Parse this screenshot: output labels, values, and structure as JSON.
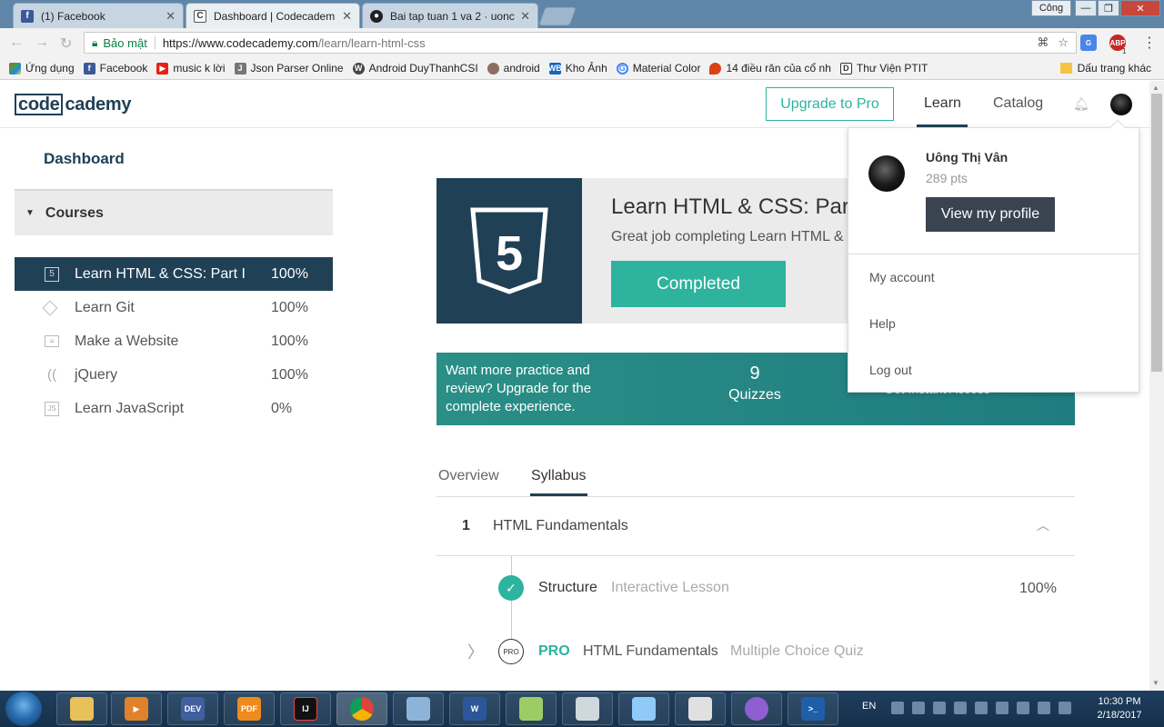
{
  "browser": {
    "tabs": [
      {
        "title": "(1) Facebook",
        "icon": "facebook-icon",
        "active": false
      },
      {
        "title": "Dashboard | Codecadem",
        "icon": "codecademy-icon",
        "active": true
      },
      {
        "title": "Bai tap tuan 1 va 2 · uonc",
        "icon": "github-icon",
        "active": false
      }
    ],
    "window_user": "Công",
    "window_buttons": [
      "minimize-icon",
      "restore-icon",
      "close-icon"
    ],
    "address": {
      "secure_label": "Bảo mật",
      "url_host": "https://www.codecademy.com",
      "url_path": "/learn/learn-html-css"
    },
    "extensions": [
      "google-translate-icon",
      "adblock-plus-icon"
    ],
    "adblock_label": "ABP",
    "adblock_count": "1",
    "bookmarks": [
      {
        "label": "Ứng dụng",
        "icon": "apps-grid-icon"
      },
      {
        "label": "Facebook",
        "icon": "facebook-icon"
      },
      {
        "label": "music k lời",
        "icon": "youtube-icon"
      },
      {
        "label": "Json Parser Online",
        "icon": "json-icon"
      },
      {
        "label": "Android DuyThanhCSI",
        "icon": "wordpress-icon"
      },
      {
        "label": "android",
        "icon": "avatar-icon"
      },
      {
        "label": "Kho Ảnh",
        "icon": "wb-icon"
      },
      {
        "label": "Material Color",
        "icon": "google-icon"
      },
      {
        "label": "14 điều răn của cổ nh",
        "icon": "flame-icon"
      },
      {
        "label": "Thư Viện PTIT",
        "icon": "d-icon"
      }
    ],
    "other_bookmarks": "Dấu trang khác"
  },
  "header": {
    "logo_box": "code",
    "logo_rest": "cademy",
    "upgrade_label": "Upgrade to Pro",
    "nav": {
      "learn": "Learn",
      "catalog": "Catalog"
    }
  },
  "sidebar": {
    "dashboard_label": "Dashboard",
    "courses_label": "Courses",
    "courses": [
      {
        "name": "Learn HTML & CSS: Part I",
        "percent": "100%",
        "icon": "html5-icon",
        "active": true
      },
      {
        "name": "Learn Git",
        "percent": "100%",
        "icon": "git-icon",
        "active": false
      },
      {
        "name": "Make a Website",
        "percent": "100%",
        "icon": "website-icon",
        "active": false
      },
      {
        "name": "jQuery",
        "percent": "100%",
        "icon": "jquery-icon",
        "active": false
      },
      {
        "name": "Learn JavaScript",
        "percent": "0%",
        "icon": "js-icon",
        "active": false
      }
    ]
  },
  "hero": {
    "title": "Learn HTML & CSS: Part I",
    "subtitle": "Great job completing Learn HTML & C",
    "status_button": "Completed",
    "badge_glyph": "5"
  },
  "promo": {
    "text": "Want more practice and review? Upgrade for the complete experience.",
    "quiz_count": "9",
    "quiz_label": "Quizzes",
    "cta": "Get Instant Access »"
  },
  "page_tabs": {
    "overview": "Overview",
    "syllabus": "Syllabus"
  },
  "syllabus": {
    "unit_number": "1",
    "unit_title": "HTML Fundamentals",
    "lessons": [
      {
        "name": "Structure",
        "type": "Interactive Lesson",
        "percent": "100%",
        "completed": true
      },
      {
        "pro_label": "PRO",
        "badge": "PRO",
        "name": "HTML Fundamentals",
        "type": "Multiple Choice Quiz"
      }
    ]
  },
  "user_menu": {
    "name": "Uông Thị Vân",
    "points": "289 pts",
    "profile_button": "View my profile",
    "links": [
      "My account",
      "Help",
      "Log out"
    ]
  },
  "taskbar": {
    "apps": [
      "file-explorer-icon",
      "media-player-icon",
      "dev-cpp-icon",
      "pdf-icon",
      "intellij-icon",
      "chrome-icon",
      "paint-icon",
      "word-icon",
      "notepad-icon",
      "calculator-icon",
      "box-icon",
      "calc2-icon",
      "github-desktop-icon",
      "powershell-icon"
    ],
    "app_labels": {
      "dev": "DEV",
      "pdf": "PDF",
      "ij": "IJ",
      "word": "W"
    },
    "language": "EN",
    "time": "10:30 PM",
    "date": "2/18/2017"
  }
}
